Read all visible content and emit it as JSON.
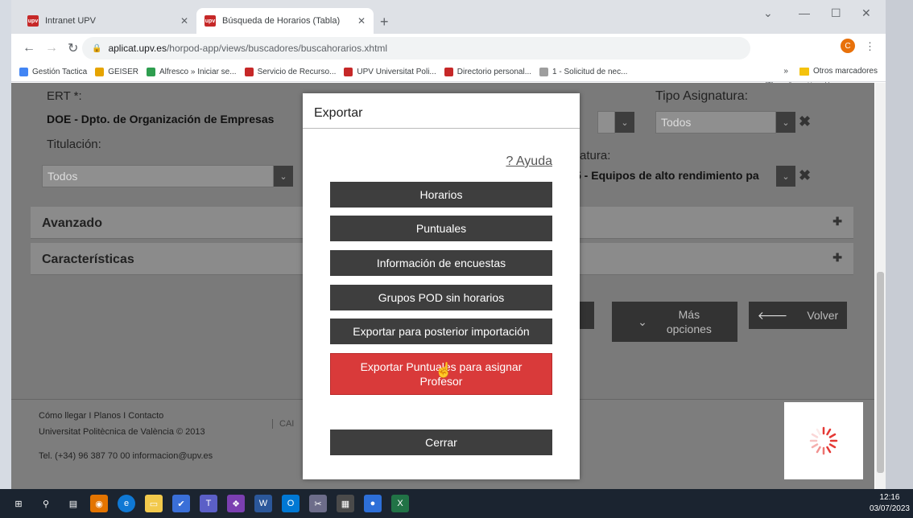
{
  "browser": {
    "tabs": [
      {
        "title": "Intranet UPV"
      },
      {
        "title": "Búsqueda de Horarios (Tabla)"
      }
    ],
    "url_host": "aplicat.upv.es",
    "url_path": "/horpod-app/views/buscadores/buscahorarios.xhtml",
    "profile_initial": "C",
    "bookmarks": [
      {
        "label": "Gestión Tactica",
        "color": "#4285f4"
      },
      {
        "label": "GEISER",
        "color": "#e6a400"
      },
      {
        "label": "Alfresco » Iniciar se...",
        "color": "#2e9e4f"
      },
      {
        "label": "Servicio de Recurso...",
        "color": "#c62828"
      },
      {
        "label": "UPV Universitat Poli...",
        "color": "#c62828"
      },
      {
        "label": "Directorio personal...",
        "color": "#c62828"
      },
      {
        "label": "1 - Solicitud de nec...",
        "color": "#9e9e9e"
      }
    ],
    "bookmarks_more": "»",
    "other_bookmarks": "Otros marcadores"
  },
  "form": {
    "ert_label": "ERT *:",
    "ert_value": "DOE - Dpto. de Organización de Empresas",
    "tipo_label": "Tipo Asignatura:",
    "tipo_value": "Todos",
    "titulacion_label": "Titulación:",
    "titulacion_value": "Todos",
    "asignatura_label": "atura:",
    "asignatura_value": "5 - Equipos de alto rendimiento pa"
  },
  "accordions": {
    "avanzado": "Avanzado",
    "caracteristicas": "Características"
  },
  "page_buttons": {
    "mas_opciones_line1": "Más",
    "mas_opciones_line2": "opciones",
    "volver": "Volver"
  },
  "footer": {
    "links": "Cómo llegar I Planos I Contacto",
    "copyright": "Universitat Politècnica de València © 2013",
    "contact": "Tel. (+34) 96 387 70 00   informacion@upv.es",
    "cam_label": "CAI"
  },
  "modal": {
    "title": "Exportar",
    "help": "? Ayuda",
    "buttons": [
      "Horarios",
      "Puntuales",
      "Información de encuestas",
      "Grupos POD sin horarios",
      "Exportar para posterior importación"
    ],
    "highlight_line1": "Exportar Puntuales para asignar",
    "highlight_line2": "Profesor",
    "close": "Cerrar"
  },
  "taskbar": {
    "time": "12:16",
    "date": "03/07/2023"
  },
  "colors": {
    "accent_red": "#d93a3a",
    "dark_button": "#3e3e3e",
    "overlay_gray": "#7a7a7a"
  }
}
